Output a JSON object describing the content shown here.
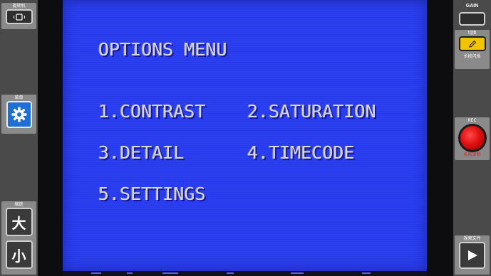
{
  "left_panel": {
    "rotate": {
      "label": "旋转机",
      "icon": "rotate-phone-icon"
    },
    "menu": {
      "label": "菜单",
      "icon": "gear-icon"
    },
    "zoom": {
      "label": "缩放",
      "large": "大",
      "small": "小"
    }
  },
  "right_panel": {
    "gain": {
      "label": "GAIN"
    },
    "edit": {
      "label": "切换",
      "sublabel": "长按闪烁",
      "icon": "pencil-icon"
    },
    "rec": {
      "label": "REC",
      "sublabel": "长按录制"
    },
    "video": {
      "label": "视频文件",
      "icon": "play-icon"
    }
  },
  "screen": {
    "title": "OPTIONS MENU",
    "items": [
      "1.CONTRAST",
      "2.SATURATION",
      "3.DETAIL",
      "4.TIMECODE",
      "5.SETTINGS"
    ]
  },
  "colors": {
    "screen_blue": "#2a3ef2",
    "panel_gray": "#4a4a4a",
    "menu_button_blue": "#1d6ed6",
    "edit_button_yellow": "#f2c400",
    "rec_red": "#e01010"
  }
}
